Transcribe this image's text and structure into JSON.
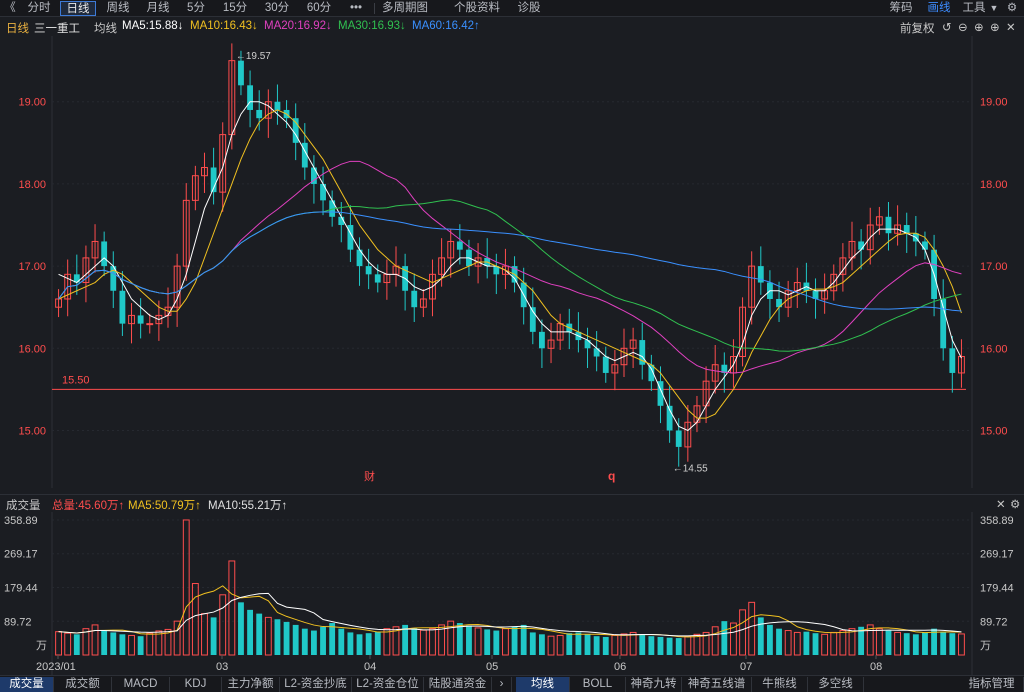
{
  "toolbar": {
    "back": "《",
    "periods": [
      "分时",
      "日线",
      "周线",
      "月线",
      "5分",
      "15分",
      "30分",
      "60分",
      "•••",
      "多周期图",
      "个股资料",
      "诊股"
    ],
    "active_period": "日线",
    "right": [
      "筹码",
      "画线",
      "工具"
    ],
    "active_right": "画线",
    "tool_caret": "▼",
    "gear": "⚙",
    "close": "✕"
  },
  "legend": {
    "period": "日线",
    "stock": "三一重工",
    "avg": "均线",
    "ma5": "MA5:15.88↓",
    "ma10": "MA10:16.43↓",
    "ma20": "MA20:16.92↓",
    "ma30": "MA30:16.93↓",
    "ma60": "MA60:16.42↑",
    "adjust": "前复权",
    "colors": {
      "ma5": "#ffffff",
      "ma10": "#f0c020",
      "ma20": "#e040c0",
      "ma30": "#30c050",
      "ma60": "#3a90ff"
    }
  },
  "chart_data": [
    {
      "type": "candlestick",
      "y_ticks": [
        "19.00",
        "18.00",
        "17.00",
        "16.00",
        "15.00"
      ],
      "ylim": [
        14.3,
        19.8
      ],
      "support_line": {
        "value": 15.5,
        "label": "15.50"
      },
      "annotations": {
        "high": "19.57",
        "low": "14.55",
        "finance_marker": "财",
        "q_marker": "q"
      },
      "close_series": [
        16.6,
        16.9,
        16.8,
        17.1,
        17.3,
        17.0,
        16.7,
        16.3,
        16.4,
        16.3,
        16.3,
        16.4,
        16.5,
        17.0,
        17.8,
        18.1,
        18.2,
        17.9,
        18.6,
        19.5,
        19.2,
        18.9,
        18.8,
        19.0,
        18.9,
        18.8,
        18.5,
        18.2,
        18.0,
        17.8,
        17.6,
        17.5,
        17.2,
        17.0,
        16.9,
        16.8,
        16.9,
        17.0,
        16.7,
        16.5,
        16.6,
        16.9,
        17.1,
        17.3,
        17.2,
        17.0,
        17.1,
        17.0,
        16.9,
        17.0,
        16.8,
        16.5,
        16.2,
        16.0,
        16.1,
        16.3,
        16.2,
        16.1,
        16.0,
        15.9,
        15.7,
        15.8,
        16.0,
        16.1,
        15.8,
        15.6,
        15.3,
        15.0,
        14.8,
        15.1,
        15.3,
        15.6,
        15.8,
        15.7,
        15.9,
        16.5,
        17.0,
        16.8,
        16.6,
        16.5,
        16.7,
        16.8,
        16.7,
        16.6,
        16.7,
        16.9,
        17.1,
        17.3,
        17.2,
        17.5,
        17.6,
        17.4,
        17.5,
        17.4,
        17.3,
        17.2,
        16.6,
        16.0,
        15.7,
        15.9
      ],
      "volume_values": [
        62,
        58,
        55,
        70,
        80,
        65,
        60,
        55,
        52,
        50,
        58,
        64,
        68,
        90,
        359,
        190,
        110,
        100,
        160,
        250,
        140,
        120,
        110,
        100,
        95,
        88,
        80,
        70,
        65,
        75,
        85,
        70,
        60,
        55,
        58,
        62,
        70,
        75,
        80,
        72,
        66,
        70,
        80,
        90,
        85,
        78,
        72,
        68,
        65,
        70,
        75,
        80,
        60,
        55,
        50,
        52,
        58,
        60,
        55,
        50,
        48,
        52,
        56,
        60,
        55,
        50,
        48,
        46,
        45,
        50,
        55,
        60,
        75,
        90,
        85,
        120,
        140,
        100,
        80,
        70,
        65,
        60,
        62,
        58,
        55,
        60,
        65,
        70,
        75,
        80,
        70,
        65,
        60,
        58,
        55,
        60,
        70,
        62,
        58,
        56
      ],
      "series": [
        {
          "name": "MA5",
          "values": [
            16.9,
            16.85,
            16.8,
            16.9,
            17.0,
            17.1,
            17.0,
            16.8,
            16.6,
            16.5,
            16.4,
            16.35,
            16.4,
            16.6,
            16.9,
            17.3,
            17.7,
            17.95,
            18.2,
            18.6,
            18.85,
            19.0,
            19.0,
            18.95,
            18.85,
            18.75,
            18.6,
            18.4,
            18.2,
            18.0,
            17.8,
            17.6,
            17.4,
            17.2,
            17.05,
            16.95,
            16.9,
            16.9,
            16.85,
            16.75,
            16.7,
            16.75,
            16.85,
            17.0,
            17.1,
            17.1,
            17.05,
            17.0,
            17.0,
            16.95,
            16.85,
            16.65,
            16.45,
            16.3,
            16.2,
            16.2,
            16.2,
            16.15,
            16.1,
            16.0,
            15.9,
            15.85,
            15.9,
            15.95,
            15.9,
            15.75,
            15.5,
            15.25,
            15.05,
            15.0,
            15.1,
            15.3,
            15.5,
            15.65,
            15.8,
            16.05,
            16.4,
            16.6,
            16.7,
            16.7,
            16.65,
            16.7,
            16.75,
            16.7,
            16.7,
            16.8,
            16.95,
            17.1,
            17.2,
            17.35,
            17.45,
            17.45,
            17.45,
            17.4,
            17.35,
            17.2,
            16.9,
            16.5,
            16.1,
            15.88
          ]
        },
        {
          "name": "MA10",
          "values": [
            16.6,
            16.65,
            16.7,
            16.75,
            16.8,
            16.9,
            16.95,
            16.9,
            16.8,
            16.7,
            16.6,
            16.5,
            16.45,
            16.45,
            16.6,
            16.8,
            17.1,
            17.4,
            17.7,
            18.0,
            18.3,
            18.55,
            18.75,
            18.85,
            18.9,
            18.85,
            18.75,
            18.6,
            18.45,
            18.3,
            18.1,
            17.9,
            17.7,
            17.5,
            17.35,
            17.2,
            17.1,
            17.0,
            16.95,
            16.9,
            16.85,
            16.8,
            16.85,
            16.9,
            16.95,
            17.0,
            17.05,
            17.05,
            17.0,
            16.95,
            16.9,
            16.8,
            16.7,
            16.55,
            16.4,
            16.3,
            16.25,
            16.2,
            16.15,
            16.1,
            16.05,
            16.0,
            15.95,
            15.9,
            15.85,
            15.8,
            15.7,
            15.55,
            15.4,
            15.25,
            15.15,
            15.15,
            15.2,
            15.35,
            15.5,
            15.7,
            15.95,
            16.15,
            16.35,
            16.5,
            16.6,
            16.65,
            16.7,
            16.72,
            16.72,
            16.75,
            16.8,
            16.9,
            17.0,
            17.1,
            17.2,
            17.3,
            17.38,
            17.4,
            17.4,
            17.35,
            17.2,
            17.0,
            16.75,
            16.43
          ]
        }
      ]
    }
  ],
  "volume": {
    "label": "成交量",
    "total": "总量:45.60万↑",
    "ma5": "MA5:50.79万↑",
    "ma10": "MA10:55.21万↑",
    "y_ticks": [
      "358.89",
      "269.17",
      "179.44",
      "89.72"
    ],
    "unit": "万",
    "x_ticks": [
      "2023/01",
      "03",
      "04",
      "05",
      "06",
      "07",
      "08"
    ],
    "close": "✕",
    "gear": "⚙"
  },
  "tabs": {
    "left": [
      "成交量",
      "成交额",
      "MACD",
      "KDJ",
      "主力净额",
      "L2-资金抄底",
      "L2-资金仓位",
      "陆股通资金",
      "›"
    ],
    "active_left": "成交量",
    "right": [
      "均线",
      "BOLL",
      "神奇九转",
      "神奇五线谱",
      "牛熊线",
      "多空线",
      "指标管理"
    ],
    "active_right": "均线"
  },
  "colors": {
    "up": "#ff4d4d",
    "down": "#20c8c8",
    "bg": "#1b1d22",
    "grid": "#2c2f36",
    "axis_text": "#ff4d4d",
    "support": "#ff4d4d"
  },
  "icons": {
    "back": "double-left-chevron-icon",
    "gear": "gear-icon",
    "close": "close-icon",
    "plus": "zoom-in-icon",
    "minus": "zoom-out-icon",
    "undo": "reset-icon"
  }
}
